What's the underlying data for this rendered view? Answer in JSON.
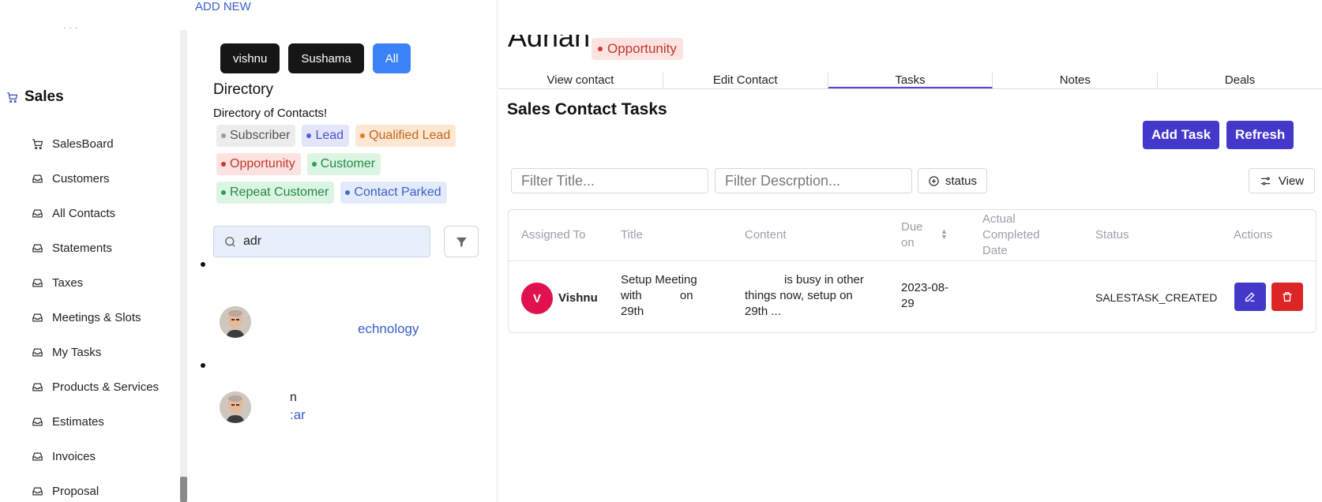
{
  "header": {
    "add_new": "ADD NEW"
  },
  "sidebar": {
    "section_label": "Sales",
    "items": [
      {
        "label": "SalesBoard",
        "icon": "cart-icon"
      },
      {
        "label": "Customers",
        "icon": "inbox-icon"
      },
      {
        "label": "All Contacts",
        "icon": "inbox-icon"
      },
      {
        "label": "Statements",
        "icon": "inbox-icon"
      },
      {
        "label": "Taxes",
        "icon": "inbox-icon"
      },
      {
        "label": "Meetings & Slots",
        "icon": "inbox-icon"
      },
      {
        "label": "My Tasks",
        "icon": "inbox-icon"
      },
      {
        "label": "Products & Services",
        "icon": "inbox-icon"
      },
      {
        "label": "Estimates",
        "icon": "inbox-icon"
      },
      {
        "label": "Invoices",
        "icon": "inbox-icon"
      },
      {
        "label": "Proposal",
        "icon": "inbox-icon"
      }
    ]
  },
  "directory": {
    "owners": [
      "vishnu",
      "Sushama",
      "All"
    ],
    "title": "Directory",
    "subtitle": "Directory of Contacts!",
    "tags": [
      {
        "label": "Subscriber",
        "bg": "#ececec",
        "fg": "#555555",
        "dot": "#9a9a9a"
      },
      {
        "label": "Lead",
        "bg": "#e3e6fb",
        "fg": "#4a52c9",
        "dot": "#5b5bd6"
      },
      {
        "label": "Qualified Lead",
        "bg": "#fde7d2",
        "fg": "#c0661f",
        "dot": "#e0781e"
      },
      {
        "label": "Opportunity",
        "bg": "#fde2e2",
        "fg": "#c0392b",
        "dot": "#d9342b"
      },
      {
        "label": "Customer",
        "bg": "#dcf5e3",
        "fg": "#1f8a45",
        "dot": "#22a355"
      },
      {
        "label": "Repeat Customer",
        "bg": "#dcf5e3",
        "fg": "#1f8a45",
        "dot": "#22a355"
      },
      {
        "label": "Contact Parked",
        "bg": "#e3ebfb",
        "fg": "#3a5fc8",
        "dot": "#3b6fd9"
      }
    ],
    "search_value": "adr",
    "contacts": [
      {
        "line1": "echnology"
      },
      {
        "line1": "n",
        "line2": ":ar"
      }
    ]
  },
  "detail": {
    "status": "Opportunity",
    "tabs": [
      "View contact",
      "Edit Contact",
      "Tasks",
      "Notes",
      "Deals"
    ],
    "active_tab": "Tasks",
    "section_title": "Sales Contact Tasks",
    "add_task": "Add Task",
    "refresh": "Refresh",
    "filter_title_placeholder": "Filter Title...",
    "filter_desc_placeholder": "Filter Descrption...",
    "status_filter": "status",
    "view": "View",
    "columns": {
      "assigned": "Assigned To",
      "title": "Title",
      "content": "Content",
      "due": "Due on",
      "actual": "Actual Completed Date",
      "status": "Status",
      "actions": "Actions"
    },
    "rows": [
      {
        "avatar_letter": "V",
        "assigned": "Vishnu",
        "title_a": "Setup Meeting",
        "title_b": "with",
        "title_c": "on",
        "title_d": "29th",
        "content_a": "is busy in other",
        "content_b": "things now, setup on",
        "content_c": "29th ...",
        "due_a": "2023-08-",
        "due_b": "29",
        "status": "SALESTASK_CREATED"
      }
    ]
  }
}
